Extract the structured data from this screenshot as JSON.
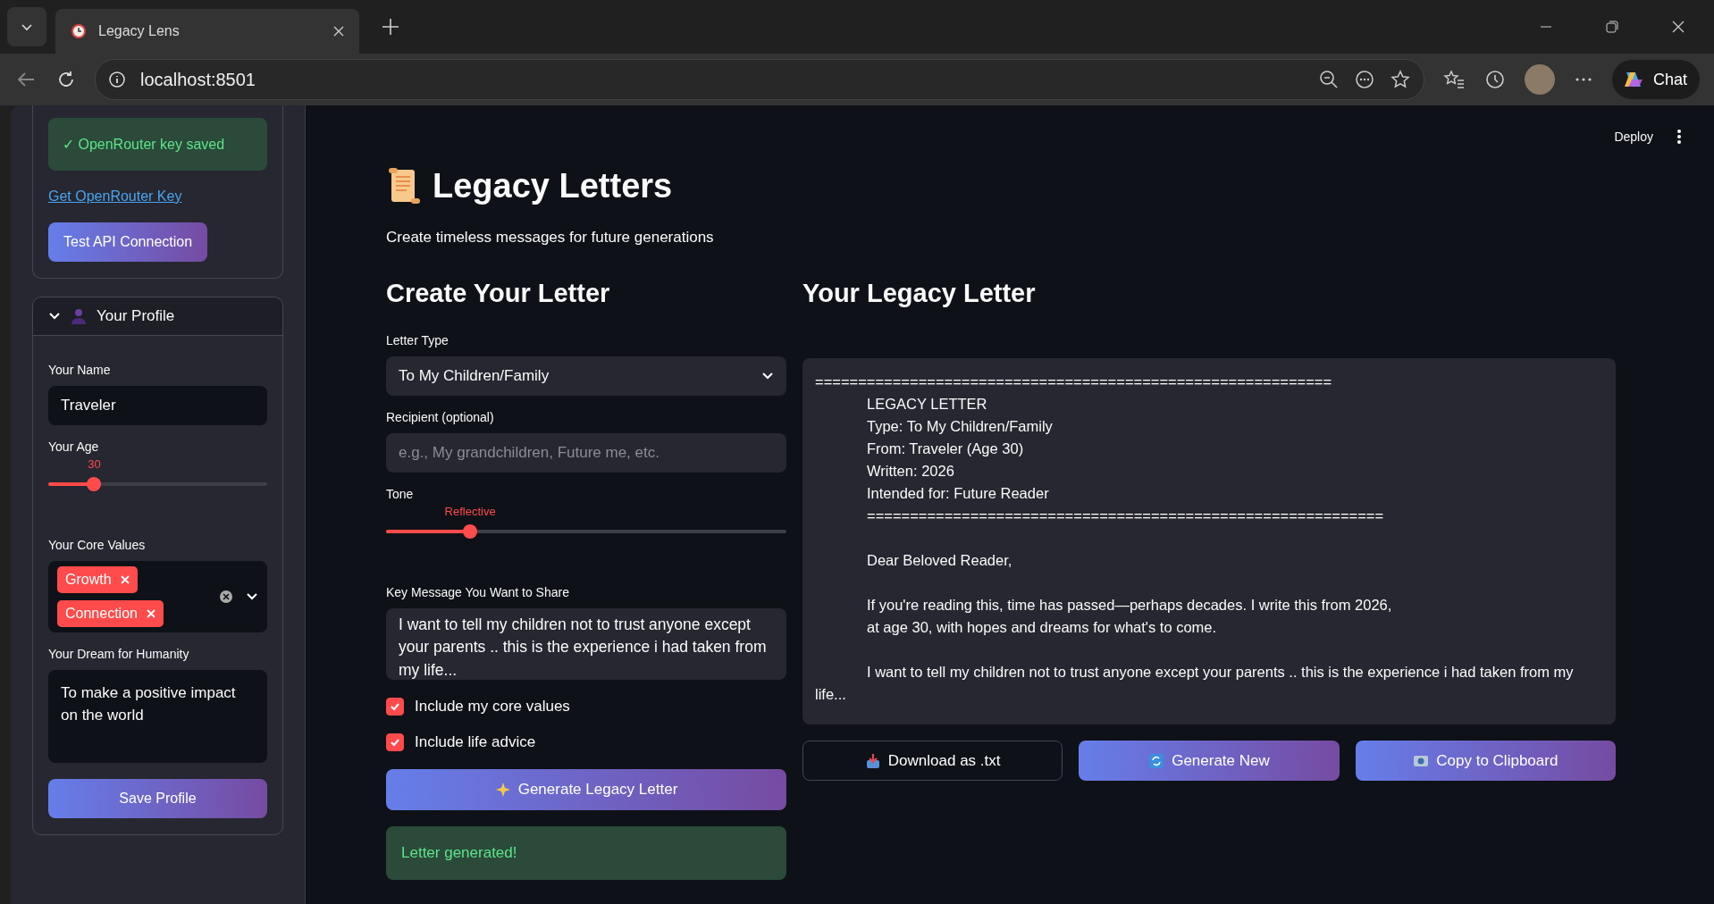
{
  "browser": {
    "tab": {
      "title": "Legacy Lens",
      "selected": true
    },
    "address": "localhost:8501",
    "chat": "Chat"
  },
  "sidebar": {
    "api_card": {
      "status": "✓ OpenRouter key saved",
      "link": "Get OpenRouter Key",
      "button": "Test API Connection"
    },
    "profile": {
      "title": "Your Profile",
      "expanded": true,
      "name": {
        "label": "Your Name",
        "value": "Traveler"
      },
      "age": {
        "label": "Your Age",
        "reading": "30",
        "level": 0.21
      },
      "values": {
        "label": "Your Core Values",
        "tags": [
          "Growth",
          "Connection"
        ]
      },
      "dream": {
        "label": "Your Dream for Humanity",
        "value": "To make a positive impact on the world"
      },
      "button": "Save Profile"
    }
  },
  "header": {
    "deploy": "Deploy"
  },
  "title": "Legacy Letters",
  "subtitle": "Create timeless messages for future generations",
  "form": {
    "heading": "Create Your Letter",
    "letter_type": {
      "label": "Letter Type",
      "value": "To My Children/Family"
    },
    "recipient": {
      "label": "Recipient (optional)",
      "placeholder": "e.g., My grandchildren, Future me, etc."
    },
    "tone": {
      "label": "Tone",
      "reading": "Reflective",
      "level": 0.21
    },
    "message": {
      "label": "Key Message You Want to Share",
      "value": "I want to tell my children not to trust anyone except your parents .. this is the experience i had taken from my life..."
    },
    "checks": [
      {
        "label": "Include my core values",
        "checked": true
      },
      {
        "label": "Include life advice",
        "checked": true
      }
    ],
    "button": "Generate Legacy Letter",
    "success": "Letter generated!"
  },
  "letter": {
    "heading": "Your Legacy Letter",
    "lines": [
      {
        "text": "============================================================",
        "indent": false,
        "gap_before": false
      },
      {
        "text": "LEGACY LETTER",
        "indent": true,
        "gap_before": false
      },
      {
        "text": "Type: To My Children/Family",
        "indent": true,
        "gap_before": false
      },
      {
        "text": "From: Traveler (Age 30)",
        "indent": true,
        "gap_before": false
      },
      {
        "text": "Written: 2026",
        "indent": true,
        "gap_before": false
      },
      {
        "text": "Intended for: Future Reader",
        "indent": true,
        "gap_before": false
      },
      {
        "text": "============================================================",
        "indent": true,
        "gap_before": false
      },
      {
        "text": "Dear Beloved Reader,",
        "indent": true,
        "gap_before": true
      },
      {
        "text": "If you're reading this, time has passed—perhaps decades. I write this from 2026,",
        "indent": true,
        "gap_before": true
      },
      {
        "text": "at age 30, with hopes and dreams for what's to come.",
        "indent": true,
        "gap_before": false
      },
      {
        "text": "I want to tell my children not to trust anyone except your parents .. this is the experience i had taken from my life...",
        "indent": true,
        "gap_before": true
      }
    ],
    "buttons": [
      {
        "label": "Download as .txt",
        "kind": "outline"
      },
      {
        "label": "Generate New",
        "kind": "gradient"
      },
      {
        "label": "Copy to Clipboard",
        "kind": "gradient"
      }
    ]
  }
}
